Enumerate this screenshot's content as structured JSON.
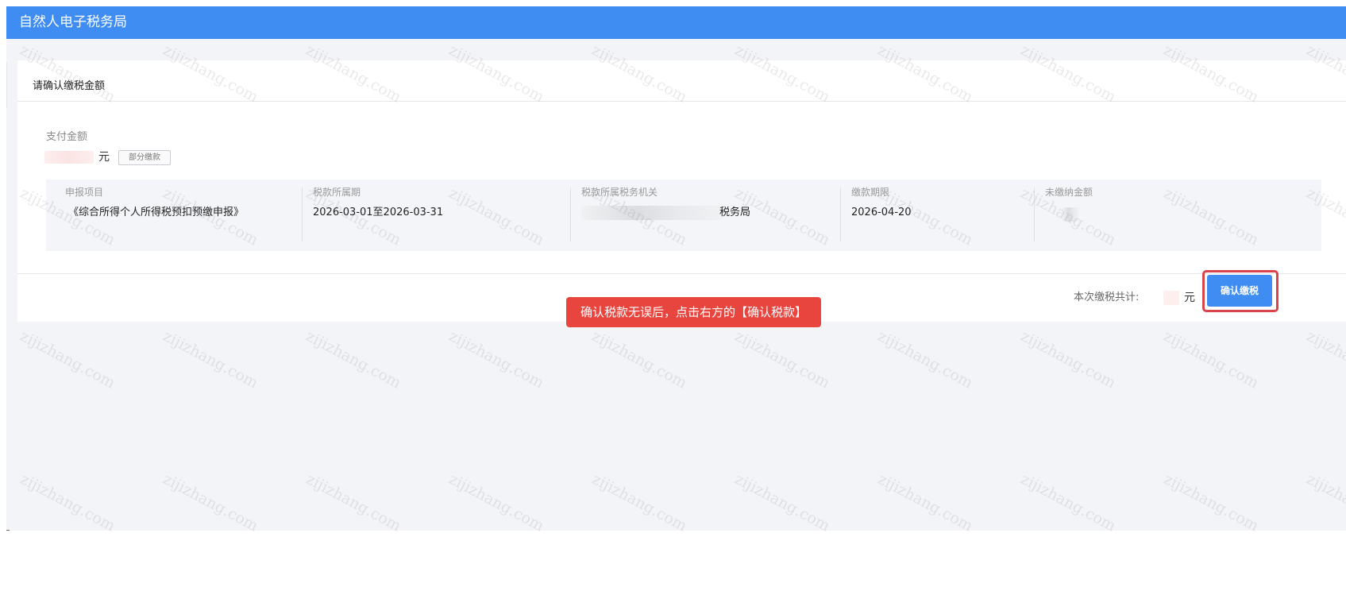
{
  "header": {
    "title": "自然人电子税务局"
  },
  "card": {
    "title": "请确认缴税金额",
    "pay_label": "支付金额",
    "currency": "元",
    "partial_label": "部分缴款"
  },
  "detail": {
    "columns": [
      {
        "header": "申报项目",
        "value": "《综合所得个人所得税预扣预缴申报》"
      },
      {
        "header": "税款所属期",
        "value": "2026-03-01至2026-03-31"
      },
      {
        "header": "税款所属税务机关",
        "value": "税务局"
      },
      {
        "header": "缴款期限",
        "value": "2026-04-20"
      },
      {
        "header": "未缴纳金额",
        "value": ""
      }
    ]
  },
  "footer": {
    "total_label": "本次缴税共计:",
    "currency": "元",
    "confirm_label": "确认缴税"
  },
  "tooltip": {
    "text": "确认税款无误后，点击右方的【确认税款】"
  },
  "watermark": {
    "text": "zijizhang.com"
  },
  "colors": {
    "header_bg": "#3f8cf2",
    "highlight_red": "#d9434a",
    "tooltip_bg": "#e8453f"
  }
}
